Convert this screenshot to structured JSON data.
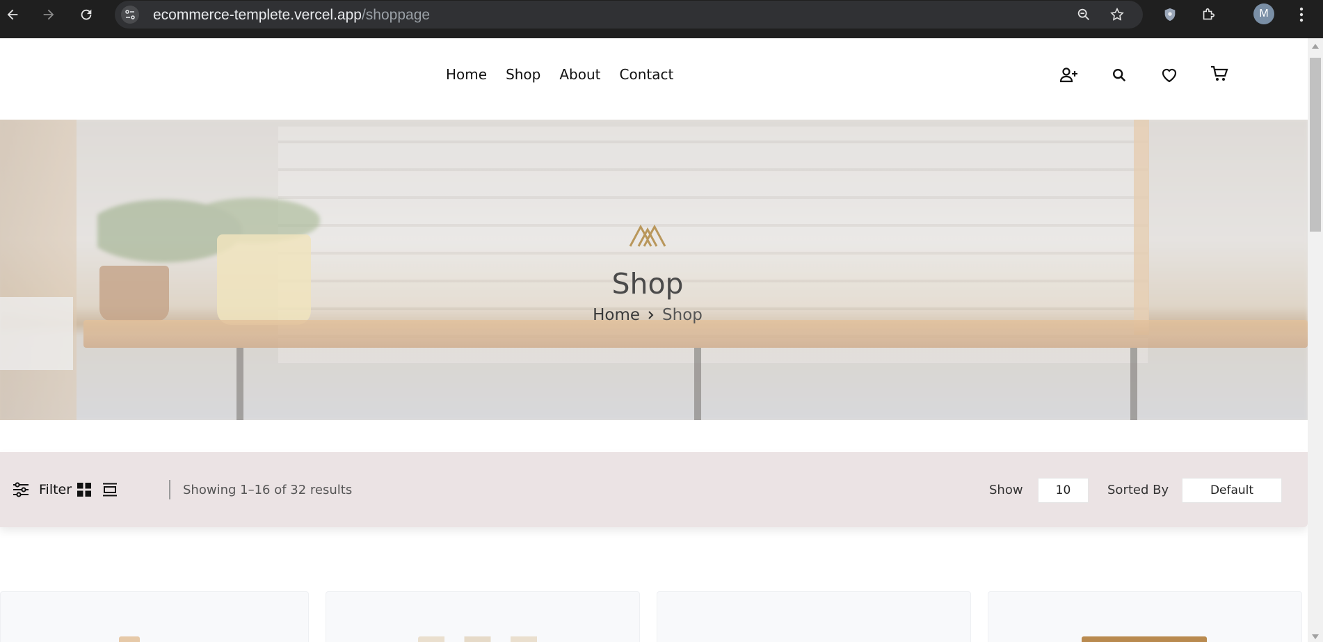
{
  "browser": {
    "url_host": "ecommerce-templete.vercel.app",
    "url_path": "/shoppage",
    "profile_initial": "M"
  },
  "nav": {
    "links": [
      "Home",
      "Shop",
      "About",
      "Contact"
    ]
  },
  "hero": {
    "title": "Shop",
    "breadcrumb_home": "Home",
    "breadcrumb_current": "Shop",
    "logo_color": "#b9975b"
  },
  "toolbar": {
    "filter_label": "Filter",
    "results_text": "Showing 1–16 of 32 results",
    "show_label": "Show",
    "show_value": "10",
    "sort_label": "Sorted By",
    "sort_value": "Default"
  },
  "colors": {
    "filter_bar_bg": "#ebe3e4",
    "chrome_bg": "#1f1f1f"
  }
}
